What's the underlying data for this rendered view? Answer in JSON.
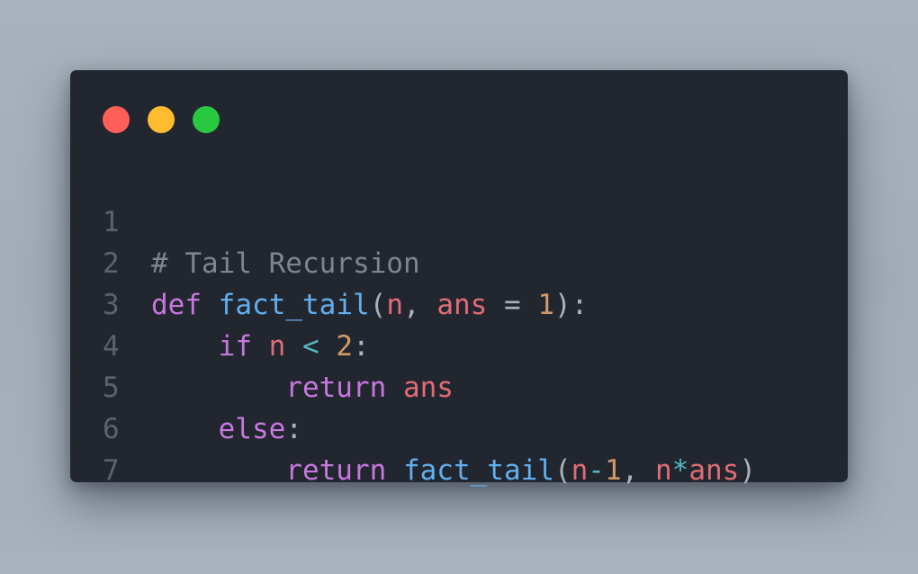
{
  "window": {
    "traffic_lights": [
      {
        "name": "close",
        "color": "#ff5f57"
      },
      {
        "name": "minimize",
        "color": "#febc2e"
      },
      {
        "name": "maximize",
        "color": "#28c840"
      }
    ]
  },
  "code": {
    "language": "python",
    "lines": [
      {
        "number": "1",
        "tokens": [
          {
            "text": "# Tail Recursion",
            "type": "comment"
          }
        ]
      },
      {
        "number": "2",
        "tokens": [
          {
            "text": "def",
            "type": "keyword"
          },
          {
            "text": " ",
            "type": "plain"
          },
          {
            "text": "fact_tail",
            "type": "function"
          },
          {
            "text": "(",
            "type": "punct"
          },
          {
            "text": "n",
            "type": "variable"
          },
          {
            "text": ", ",
            "type": "punct"
          },
          {
            "text": "ans",
            "type": "variable"
          },
          {
            "text": " = ",
            "type": "punct"
          },
          {
            "text": "1",
            "type": "number"
          },
          {
            "text": "):",
            "type": "punct"
          }
        ]
      },
      {
        "number": "3",
        "tokens": [
          {
            "text": "    ",
            "type": "plain"
          },
          {
            "text": "if",
            "type": "keyword"
          },
          {
            "text": " ",
            "type": "plain"
          },
          {
            "text": "n",
            "type": "variable"
          },
          {
            "text": " ",
            "type": "plain"
          },
          {
            "text": "<",
            "type": "operator"
          },
          {
            "text": " ",
            "type": "plain"
          },
          {
            "text": "2",
            "type": "number"
          },
          {
            "text": ":",
            "type": "punct"
          }
        ]
      },
      {
        "number": "4",
        "tokens": [
          {
            "text": "        ",
            "type": "plain"
          },
          {
            "text": "return",
            "type": "keyword"
          },
          {
            "text": " ",
            "type": "plain"
          },
          {
            "text": "ans",
            "type": "variable"
          }
        ]
      },
      {
        "number": "5",
        "tokens": [
          {
            "text": "    ",
            "type": "plain"
          },
          {
            "text": "else",
            "type": "keyword"
          },
          {
            "text": ":",
            "type": "punct"
          }
        ]
      },
      {
        "number": "6",
        "tokens": [
          {
            "text": "        ",
            "type": "plain"
          },
          {
            "text": "return",
            "type": "keyword"
          },
          {
            "text": " ",
            "type": "plain"
          },
          {
            "text": "fact_tail",
            "type": "function"
          },
          {
            "text": "(",
            "type": "punct"
          },
          {
            "text": "n",
            "type": "variable"
          },
          {
            "text": "-",
            "type": "operator"
          },
          {
            "text": "1",
            "type": "number"
          },
          {
            "text": ", ",
            "type": "punct"
          },
          {
            "text": "n",
            "type": "variable"
          },
          {
            "text": "*",
            "type": "operator"
          },
          {
            "text": "ans",
            "type": "variable"
          },
          {
            "text": ")",
            "type": "punct"
          }
        ]
      },
      {
        "number": "7",
        "tokens": []
      }
    ]
  },
  "colors": {
    "background": "#a7b1bb",
    "editor_background": "#22262f",
    "line_number": "#5b6270",
    "comment": "#7f848e",
    "keyword": "#c678dd",
    "function": "#61afef",
    "variable": "#e06c75",
    "number": "#d19a66",
    "operator": "#56b6c2",
    "punctuation": "#abb2bf"
  }
}
